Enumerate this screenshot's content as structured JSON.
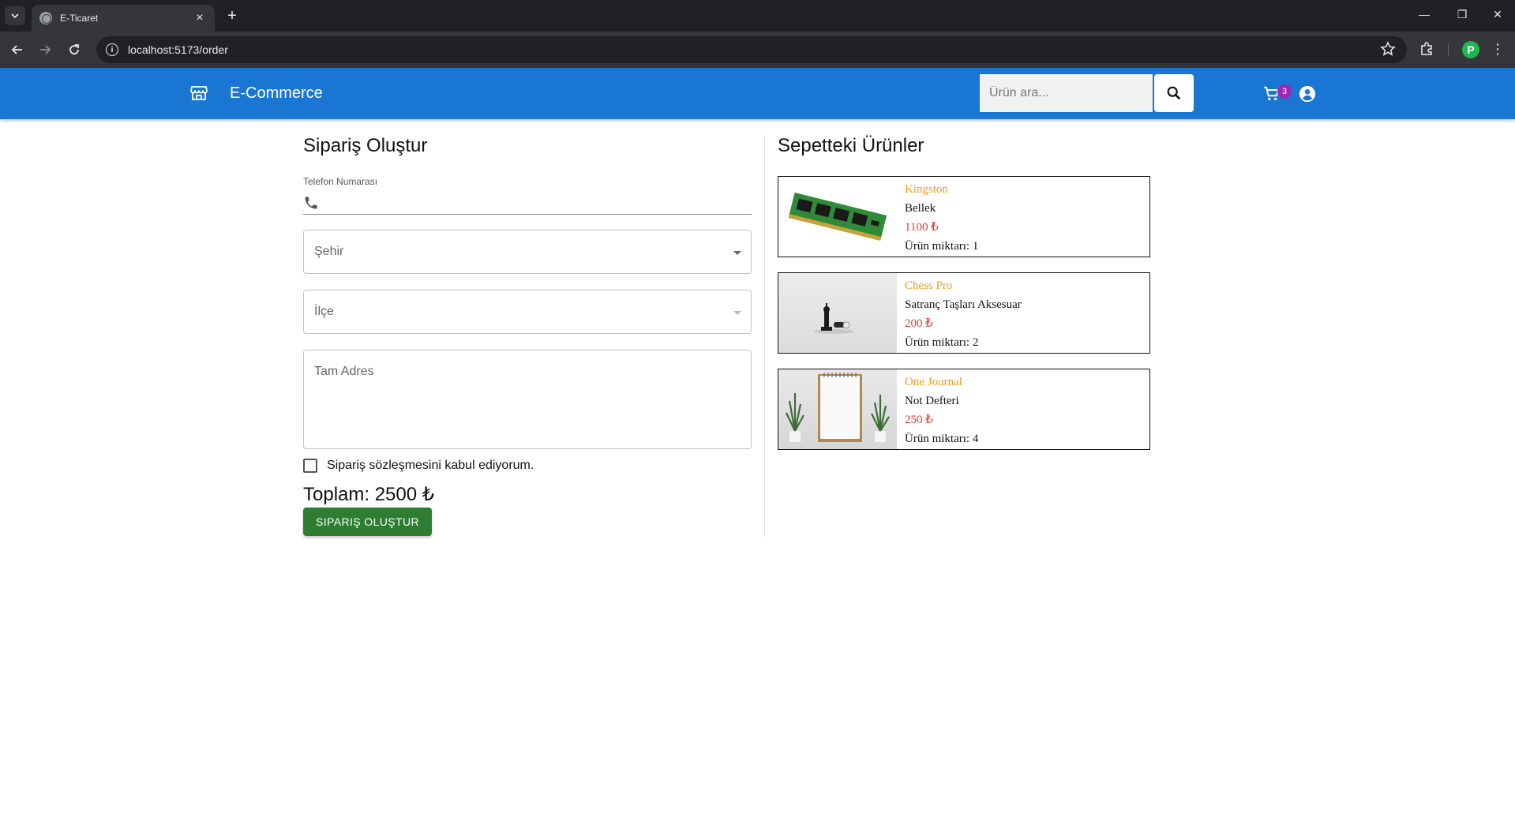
{
  "browser": {
    "tab_title": "E-Ticaret",
    "url": "localhost:5173/order",
    "profile_initial": "P"
  },
  "appbar": {
    "brand": "E-Commerce",
    "search_placeholder": "Ürün ara...",
    "cart_count": "3",
    "color": "#1976d2"
  },
  "order_form": {
    "title": "Sipariş Oluştur",
    "phone_label": "Telefon Numarası",
    "phone_value": "",
    "city_placeholder": "Şehir",
    "district_placeholder": "İlçe",
    "address_placeholder": "Tam Adres",
    "agreement_label": "Sipariş sözleşmesini kabul ediyorum.",
    "agreement_checked": false,
    "total_label": "Toplam: 2500 ₺",
    "submit_label": "SIPARIŞ OLUŞTUR",
    "submit_color": "#2e7d32"
  },
  "cart": {
    "title": "Sepetteki Ürünler",
    "items": [
      {
        "brand": "Kingston",
        "name": "Bellek",
        "price": "1100 ₺",
        "quantity": "Ürün miktarı: 1",
        "image": "ram-module"
      },
      {
        "brand": "Chess Pro",
        "name": "Satranç Taşları Aksesuar",
        "price": "200 ₺",
        "quantity": "Ürün miktarı: 2",
        "image": "chess-pieces"
      },
      {
        "brand": "One Journal",
        "name": "Not Defteri",
        "price": "250 ₺",
        "quantity": "Ürün miktarı: 4",
        "image": "notebook"
      }
    ]
  }
}
